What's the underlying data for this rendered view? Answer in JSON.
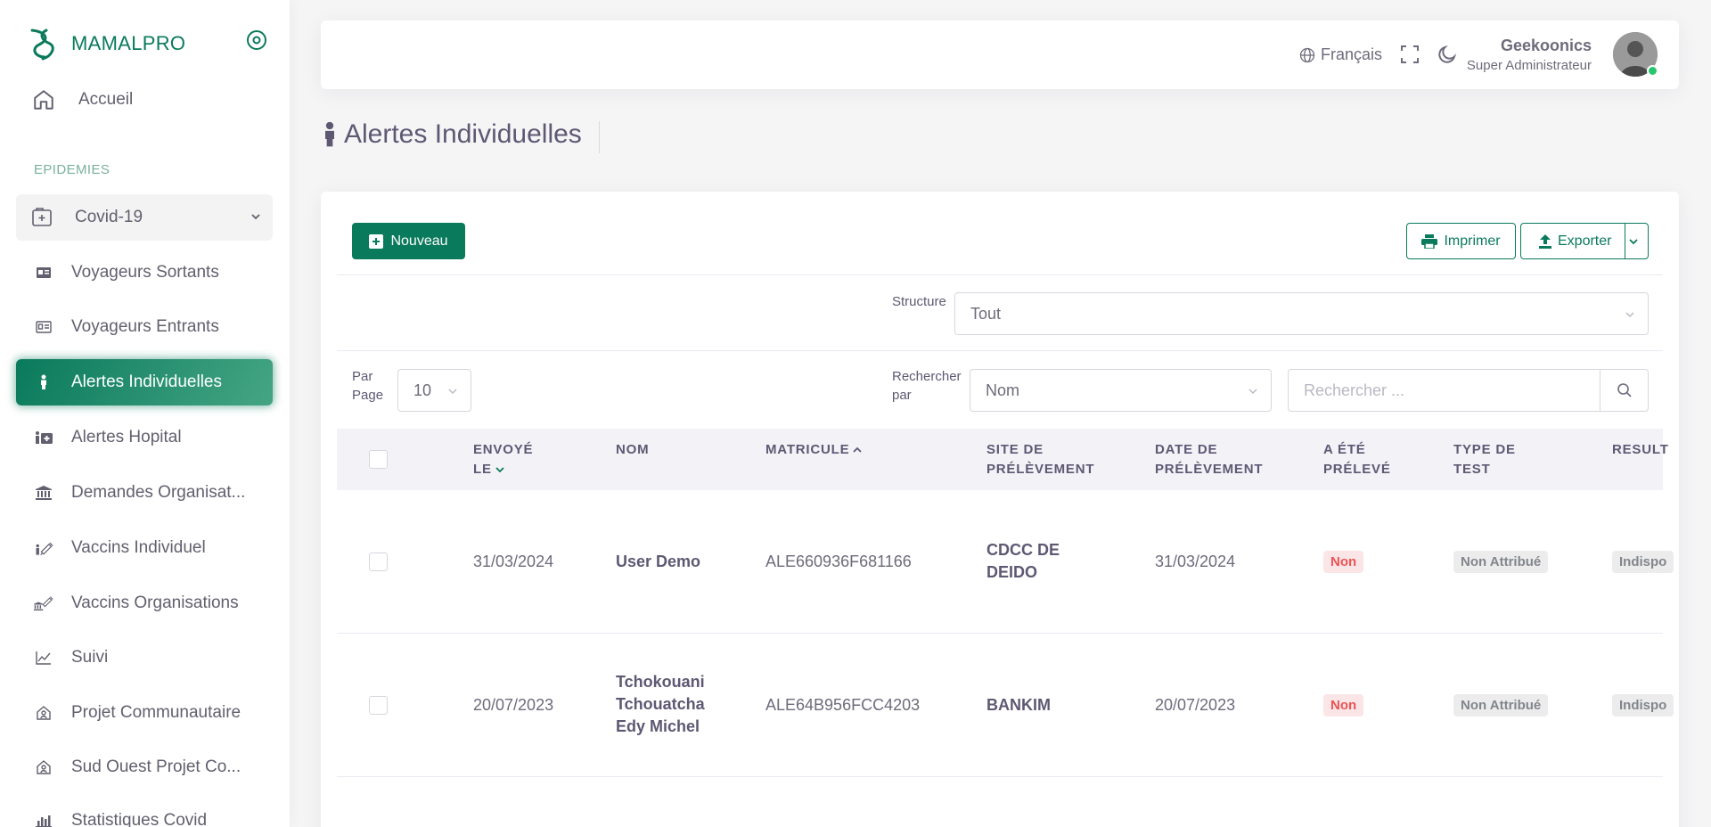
{
  "brand": {
    "name": "MAMALPRO",
    "accent": "#0a7a5c"
  },
  "sidebar": {
    "home_label": "Accueil",
    "section_title": "EPIDEMIES",
    "group_label": "Covid-19",
    "items": [
      {
        "label": "Voyageurs Sortants",
        "icon": "id-card-icon"
      },
      {
        "label": "Voyageurs Entrants",
        "icon": "id-card-outline-icon"
      },
      {
        "label": "Alertes Individuelles",
        "icon": "person-icon",
        "active": true
      },
      {
        "label": "Alertes Hopital",
        "icon": "hospital-icon"
      },
      {
        "label": "Demandes Organisat...",
        "icon": "institution-icon"
      },
      {
        "label": "Vaccins Individuel",
        "icon": "person-syringe-icon"
      },
      {
        "label": "Vaccins Organisations",
        "icon": "institution-syringe-icon"
      },
      {
        "label": "Suivi",
        "icon": "trend-chart-icon"
      },
      {
        "label": "Projet Communautaire",
        "icon": "community-icon"
      },
      {
        "label": "Sud Ouest Projet Co...",
        "icon": "community-icon"
      },
      {
        "label": "Statistiques Covid",
        "icon": "bar-chart-icon"
      }
    ]
  },
  "navbar": {
    "language": "Français",
    "user_name": "Geekoonics",
    "user_role": "Super Administrateur",
    "status_color": "#28c76f"
  },
  "page": {
    "title": "Alertes Individuelles"
  },
  "toolbar": {
    "new_label": "Nouveau",
    "print_label": "Imprimer",
    "export_label": "Exporter"
  },
  "filters": {
    "structure_label": "Structure",
    "structure_value": "Tout",
    "per_page_label_1": "Par",
    "per_page_label_2": "Page",
    "per_page_value": "10",
    "search_by_label_1": "Rechercher",
    "search_by_label_2": "par",
    "search_by_value": "Nom",
    "search_placeholder": "Rechercher ..."
  },
  "table": {
    "columns": [
      {
        "line1": "ENVOYÉ",
        "line2": "LE"
      },
      {
        "line1": "NOM",
        "line2": ""
      },
      {
        "line1": "MATRICULE",
        "line2": ""
      },
      {
        "line1": "SITE DE",
        "line2": "PRÉLÈVEMENT"
      },
      {
        "line1": "DATE DE",
        "line2": "PRÉLÈVEMENT"
      },
      {
        "line1": "A ÉTÉ",
        "line2": "PRÉLEVÉ"
      },
      {
        "line1": "TYPE DE",
        "line2": "TEST"
      },
      {
        "line1": "RESULT",
        "line2": ""
      }
    ],
    "rows": [
      {
        "sent": "31/03/2024",
        "name": [
          "User Demo"
        ],
        "matricule": "ALE660936F681166",
        "site": [
          "CDCC DE",
          "DEIDO"
        ],
        "date": "31/03/2024",
        "sampled": "Non",
        "test_type": "Non Attribué",
        "result": "Indispo"
      },
      {
        "sent": "20/07/2023",
        "name": [
          "Tchokouani",
          "Tchouatcha",
          "Edy Michel"
        ],
        "matricule": "ALE64B956FCC4203",
        "site": [
          "BANKIM"
        ],
        "date": "20/07/2023",
        "sampled": "Non",
        "test_type": "Non Attribué",
        "result": "Indispo"
      }
    ]
  }
}
